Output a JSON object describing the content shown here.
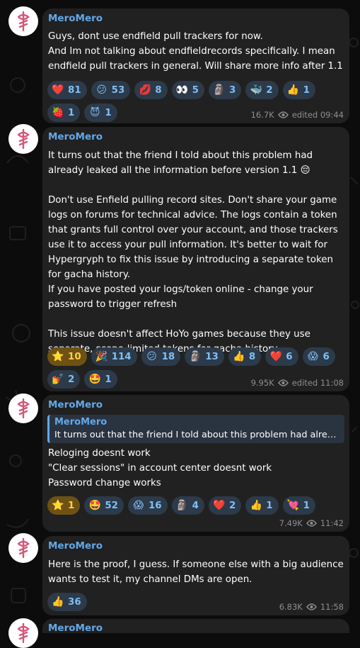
{
  "channel": {
    "colors": {
      "accent": "#63a9ea",
      "bubble": "#212121",
      "pill": "#2c3a4a",
      "pill_selected": "#6e5213"
    }
  },
  "posts": [
    {
      "author": "MeroMero",
      "text": "Guys, dont use endfield pull trackers for now.\nAnd Im not talking about endfieldrecords specifically. I mean endfield pull trackers in general. Will share more info after 1.1",
      "reactions_row1": [
        {
          "icon": "red-heart-emoji",
          "emoji": "❤️",
          "count": "81"
        },
        {
          "icon": "confused-face-emoji",
          "emoji": "😕",
          "count": "53"
        },
        {
          "icon": "kiss-lips-emoji",
          "emoji": "💋",
          "count": "8"
        },
        {
          "icon": "eyes-emoji",
          "emoji": "👀",
          "count": "5"
        },
        {
          "icon": "moai-emoji",
          "emoji": "🗿",
          "count": "3"
        },
        {
          "icon": "whale-emoji",
          "emoji": "🐳",
          "count": "2"
        },
        {
          "icon": "thumbs-up-emoji",
          "emoji": "👍",
          "count": "1"
        }
      ],
      "reactions_row2": [
        {
          "icon": "strawberry-emoji",
          "emoji": "🍓",
          "count": "1"
        },
        {
          "icon": "smiling-devil-emoji",
          "emoji": "😈",
          "count": "1"
        }
      ],
      "views": "16.7K",
      "time": "edited  09:44"
    },
    {
      "author": "MeroMero",
      "text": "It turns out that the friend I told about this problem had already leaked all the information before version 1.1 😔\n\nDon't use Enfield pulling record sites. Don't share your game logs on forums for technical advice. The logs contain a token that grants full control over your account, and those trackers use it to access your pull information. It's better to wait for Hypergryph to fix this issue by introducing a separate token for gacha history.\nIf you have posted your logs/token online - change your password to trigger refresh\n\nThis issue doesn't affect HoYo games because they use separate, scope-limited tokens for gacha history.",
      "reactions_row1": [
        {
          "icon": "star-emoji",
          "emoji": "⭐",
          "count": "10",
          "selected": true
        },
        {
          "icon": "party-popper-emoji",
          "emoji": "🎉",
          "count": "114"
        },
        {
          "icon": "confused-face-emoji",
          "emoji": "😕",
          "count": "18"
        },
        {
          "icon": "moai-emoji",
          "emoji": "🗿",
          "count": "13"
        },
        {
          "icon": "thumbs-up-emoji",
          "emoji": "👍",
          "count": "8"
        },
        {
          "icon": "red-heart-emoji",
          "emoji": "❤️",
          "count": "6"
        },
        {
          "icon": "screaming-face-emoji",
          "emoji": "😱",
          "count": "6"
        }
      ],
      "reactions_row2": [
        {
          "icon": "nail-polish-emoji",
          "emoji": "💅",
          "count": "2"
        },
        {
          "icon": "star-struck-emoji",
          "emoji": "🤩",
          "count": "1"
        }
      ],
      "views": "9.95K",
      "time": "edited  11:08"
    },
    {
      "author": "MeroMero",
      "reply": {
        "author": "MeroMero",
        "text": "It turns out that the friend I told about this problem had already l…"
      },
      "text": "Reloging doesnt work\n\"Clear sessions\" in account center doesnt work\nPassword change works",
      "reactions_row1": [
        {
          "icon": "star-emoji",
          "emoji": "⭐",
          "count": "1",
          "selected": true
        },
        {
          "icon": "star-struck-emoji",
          "emoji": "🤩",
          "count": "52"
        },
        {
          "icon": "screaming-face-emoji",
          "emoji": "😱",
          "count": "16"
        },
        {
          "icon": "moai-emoji",
          "emoji": "🗿",
          "count": "4"
        },
        {
          "icon": "red-heart-emoji",
          "emoji": "❤️",
          "count": "2"
        },
        {
          "icon": "thumbs-up-emoji",
          "emoji": "👍",
          "count": "1"
        },
        {
          "icon": "heart-with-ribbon-emoji",
          "emoji": "💘",
          "count": "1"
        }
      ],
      "views": "7.49K",
      "time": "11:42"
    },
    {
      "author": "MeroMero",
      "text": "Here is the proof, I guess. If someone else with a big audience wants to test it, my channel DMs are open.",
      "reactions_row1": [
        {
          "icon": "thumbs-up-emoji",
          "emoji": "👍",
          "count": "36"
        }
      ],
      "views": "6.83K",
      "time": "11:58"
    },
    {
      "author": "MeroMero"
    }
  ]
}
